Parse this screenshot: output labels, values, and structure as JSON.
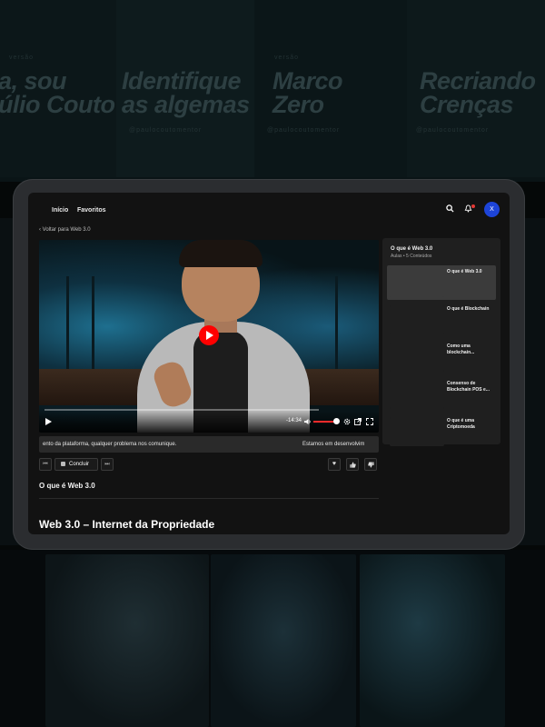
{
  "background": {
    "posters": [
      {
        "title_lines": [
          "a, sou",
          "úlio Couto"
        ],
        "handle": "",
        "kicker": "versão"
      },
      {
        "title_lines": [
          "Identifique",
          "as algemas"
        ],
        "handle": "@paulocoutomentor",
        "kicker": ""
      },
      {
        "title_lines": [
          "Marco",
          "Zero"
        ],
        "handle": "@paulocoutomentor",
        "kicker": "versão"
      },
      {
        "title_lines": [
          "Recriando",
          "Crenças"
        ],
        "handle": "@paulocoutomentor",
        "kicker": ""
      }
    ]
  },
  "nav": {
    "home": "Início",
    "favorites": "Favoritos",
    "avatar_initial": "X"
  },
  "icons": {
    "search": "search-icon",
    "bell": "bell-icon"
  },
  "back_link": "‹ Voltar para Web 3.0",
  "player": {
    "time": "-14:34",
    "accent": "#ff0000"
  },
  "marquee": {
    "left_text": "ento da plataforma, qualquer problema nos comunique.",
    "right_text": "Estamos em desenvolvim"
  },
  "actions": {
    "prev": "⏮",
    "complete_label": "Concluir",
    "next": "⏭",
    "heart": "♥",
    "like": "👍",
    "dislike": "👎"
  },
  "lesson": {
    "title": "O que é Web 3.0",
    "section_heading": "Web 3.0 – Internet da Propriedade"
  },
  "playlist": {
    "title": "O que é Web 3.0",
    "subtitle": "Aulas • 5 Conteúdos",
    "items": [
      {
        "label": "O que é Web 3.0"
      },
      {
        "label": "O que é Blockchain"
      },
      {
        "label": "Como uma blockchain..."
      },
      {
        "label": "Consenso de Blockchain POS e..."
      },
      {
        "label": "O que é uma Criptomoeda"
      }
    ]
  }
}
